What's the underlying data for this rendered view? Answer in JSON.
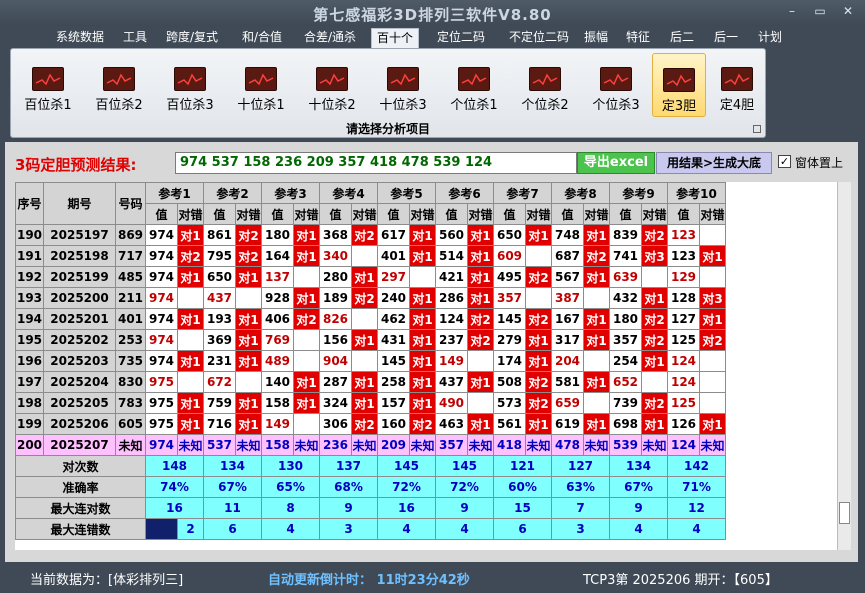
{
  "window": {
    "title": "第七感福彩3D排列三软件V8.80",
    "btn_min": "–",
    "btn_max": "▭",
    "btn_close": "✕"
  },
  "menu": [
    "系统数据",
    "工具",
    "跨度/复式",
    "和/合值",
    "合差/通杀",
    "百十个",
    "定位二码",
    "不定位二码",
    "振幅",
    "特征",
    "后二",
    "后一",
    "计划"
  ],
  "ribbon": {
    "buttons": [
      "百位杀1",
      "百位杀2",
      "百位杀3",
      "十位杀1",
      "十位杀2",
      "十位杀3",
      "个位杀1",
      "个位杀2",
      "个位杀3",
      "定3胆",
      "定4胆"
    ],
    "selected": "定3胆",
    "caption": "请选择分析项目"
  },
  "result": {
    "label": "3码定胆预测结果:",
    "value": "974 537 158 236 209 357 418 478 539 124",
    "excel_button": "导出excel",
    "generate_button": "用结果>生成大底",
    "ontop_check": "✓",
    "ontop_label": "窗体置上"
  },
  "table": {
    "col_headers": [
      "序号",
      "期号",
      "号码"
    ],
    "groups": [
      "参考1",
      "参考2",
      "参考3",
      "参考4",
      "参考5",
      "参考6",
      "参考7",
      "参考8",
      "参考9",
      "参考10"
    ],
    "sub_value": "值",
    "sub_result": "对错",
    "rows": [
      {
        "no": "190",
        "issue": "2025197",
        "num": "869",
        "cells": [
          [
            "974",
            "对1"
          ],
          [
            "861",
            "对2"
          ],
          [
            "180",
            "对1"
          ],
          [
            "368",
            "对2"
          ],
          [
            "617",
            "对1"
          ],
          [
            "560",
            "对1"
          ],
          [
            "650",
            "对1"
          ],
          [
            "748",
            "对1"
          ],
          [
            "839",
            "对2"
          ],
          [
            "123",
            ""
          ]
        ]
      },
      {
        "no": "191",
        "issue": "2025198",
        "num": "717",
        "cells": [
          [
            "974",
            "对2"
          ],
          [
            "795",
            "对2"
          ],
          [
            "164",
            "对1"
          ],
          [
            "340",
            ""
          ],
          [
            "401",
            "对1"
          ],
          [
            "514",
            "对1"
          ],
          [
            "609",
            ""
          ],
          [
            "687",
            "对2"
          ],
          [
            "741",
            "对3"
          ],
          [
            "123",
            "对1"
          ]
        ]
      },
      {
        "no": "192",
        "issue": "2025199",
        "num": "485",
        "cells": [
          [
            "974",
            "对1"
          ],
          [
            "650",
            "对1"
          ],
          [
            "137",
            ""
          ],
          [
            "280",
            "对1"
          ],
          [
            "297",
            ""
          ],
          [
            "421",
            "对1"
          ],
          [
            "495",
            "对2"
          ],
          [
            "567",
            "对1"
          ],
          [
            "639",
            ""
          ],
          [
            "129",
            ""
          ]
        ]
      },
      {
        "no": "193",
        "issue": "2025200",
        "num": "211",
        "cells": [
          [
            "974",
            ""
          ],
          [
            "437",
            ""
          ],
          [
            "928",
            "对1"
          ],
          [
            "189",
            "对2"
          ],
          [
            "240",
            "对1"
          ],
          [
            "286",
            "对1"
          ],
          [
            "357",
            ""
          ],
          [
            "387",
            ""
          ],
          [
            "432",
            "对1"
          ],
          [
            "128",
            "对3"
          ]
        ]
      },
      {
        "no": "194",
        "issue": "2025201",
        "num": "401",
        "cells": [
          [
            "974",
            "对1"
          ],
          [
            "193",
            "对1"
          ],
          [
            "406",
            "对2"
          ],
          [
            "826",
            ""
          ],
          [
            "462",
            "对1"
          ],
          [
            "124",
            "对2"
          ],
          [
            "145",
            "对2"
          ],
          [
            "167",
            "对1"
          ],
          [
            "180",
            "对2"
          ],
          [
            "127",
            "对1"
          ]
        ]
      },
      {
        "no": "195",
        "issue": "2025202",
        "num": "253",
        "cells": [
          [
            "974",
            ""
          ],
          [
            "369",
            "对1"
          ],
          [
            "769",
            ""
          ],
          [
            "156",
            "对1"
          ],
          [
            "431",
            "对1"
          ],
          [
            "237",
            "对2"
          ],
          [
            "279",
            "对1"
          ],
          [
            "317",
            "对1"
          ],
          [
            "357",
            "对2"
          ],
          [
            "125",
            "对2"
          ]
        ]
      },
      {
        "no": "196",
        "issue": "2025203",
        "num": "735",
        "cells": [
          [
            "974",
            "对1"
          ],
          [
            "231",
            "对1"
          ],
          [
            "489",
            ""
          ],
          [
            "904",
            ""
          ],
          [
            "145",
            "对1"
          ],
          [
            "149",
            ""
          ],
          [
            "174",
            "对1"
          ],
          [
            "204",
            ""
          ],
          [
            "254",
            "对1"
          ],
          [
            "124",
            ""
          ]
        ]
      },
      {
        "no": "197",
        "issue": "2025204",
        "num": "830",
        "cells": [
          [
            "975",
            ""
          ],
          [
            "672",
            ""
          ],
          [
            "140",
            "对1"
          ],
          [
            "287",
            "对1"
          ],
          [
            "258",
            "对1"
          ],
          [
            "437",
            "对1"
          ],
          [
            "508",
            "对2"
          ],
          [
            "581",
            "对1"
          ],
          [
            "652",
            ""
          ],
          [
            "124",
            ""
          ]
        ]
      },
      {
        "no": "198",
        "issue": "2025205",
        "num": "783",
        "cells": [
          [
            "975",
            "对1"
          ],
          [
            "759",
            "对1"
          ],
          [
            "158",
            "对1"
          ],
          [
            "324",
            "对1"
          ],
          [
            "157",
            "对1"
          ],
          [
            "490",
            ""
          ],
          [
            "573",
            "对2"
          ],
          [
            "659",
            ""
          ],
          [
            "739",
            "对2"
          ],
          [
            "125",
            ""
          ]
        ]
      },
      {
        "no": "199",
        "issue": "2025206",
        "num": "605",
        "cells": [
          [
            "975",
            "对1"
          ],
          [
            "716",
            "对1"
          ],
          [
            "149",
            ""
          ],
          [
            "306",
            "对2"
          ],
          [
            "160",
            "对2"
          ],
          [
            "463",
            "对1"
          ],
          [
            "561",
            "对1"
          ],
          [
            "619",
            "对1"
          ],
          [
            "698",
            "对1"
          ],
          [
            "126",
            "对1"
          ]
        ]
      }
    ],
    "next_row": {
      "no": "200",
      "issue": "2025207",
      "num": "未知",
      "values": [
        "974",
        "537",
        "158",
        "236",
        "209",
        "357",
        "418",
        "478",
        "539",
        "124"
      ],
      "unknown": "未知"
    },
    "stats": [
      {
        "label": "对次数",
        "values": [
          "148",
          "134",
          "130",
          "137",
          "145",
          "145",
          "121",
          "127",
          "134",
          "142"
        ]
      },
      {
        "label": "准确率",
        "values": [
          "74%",
          "67%",
          "65%",
          "68%",
          "72%",
          "72%",
          "60%",
          "63%",
          "67%",
          "71%"
        ]
      },
      {
        "label": "最大连对数",
        "values": [
          "16",
          "11",
          "8",
          "9",
          "16",
          "9",
          "15",
          "7",
          "9",
          "12"
        ]
      },
      {
        "label": "最大连错数",
        "values": [
          "2",
          "6",
          "4",
          "3",
          "4",
          "4",
          "6",
          "3",
          "4",
          "4"
        ]
      }
    ]
  },
  "status": {
    "current_data": "当前数据为：[体彩排列三]",
    "countdown": "自动更新倒计时：   11时23分42秒",
    "period_info": "TCP3第  2025206  期开：【605】"
  }
}
